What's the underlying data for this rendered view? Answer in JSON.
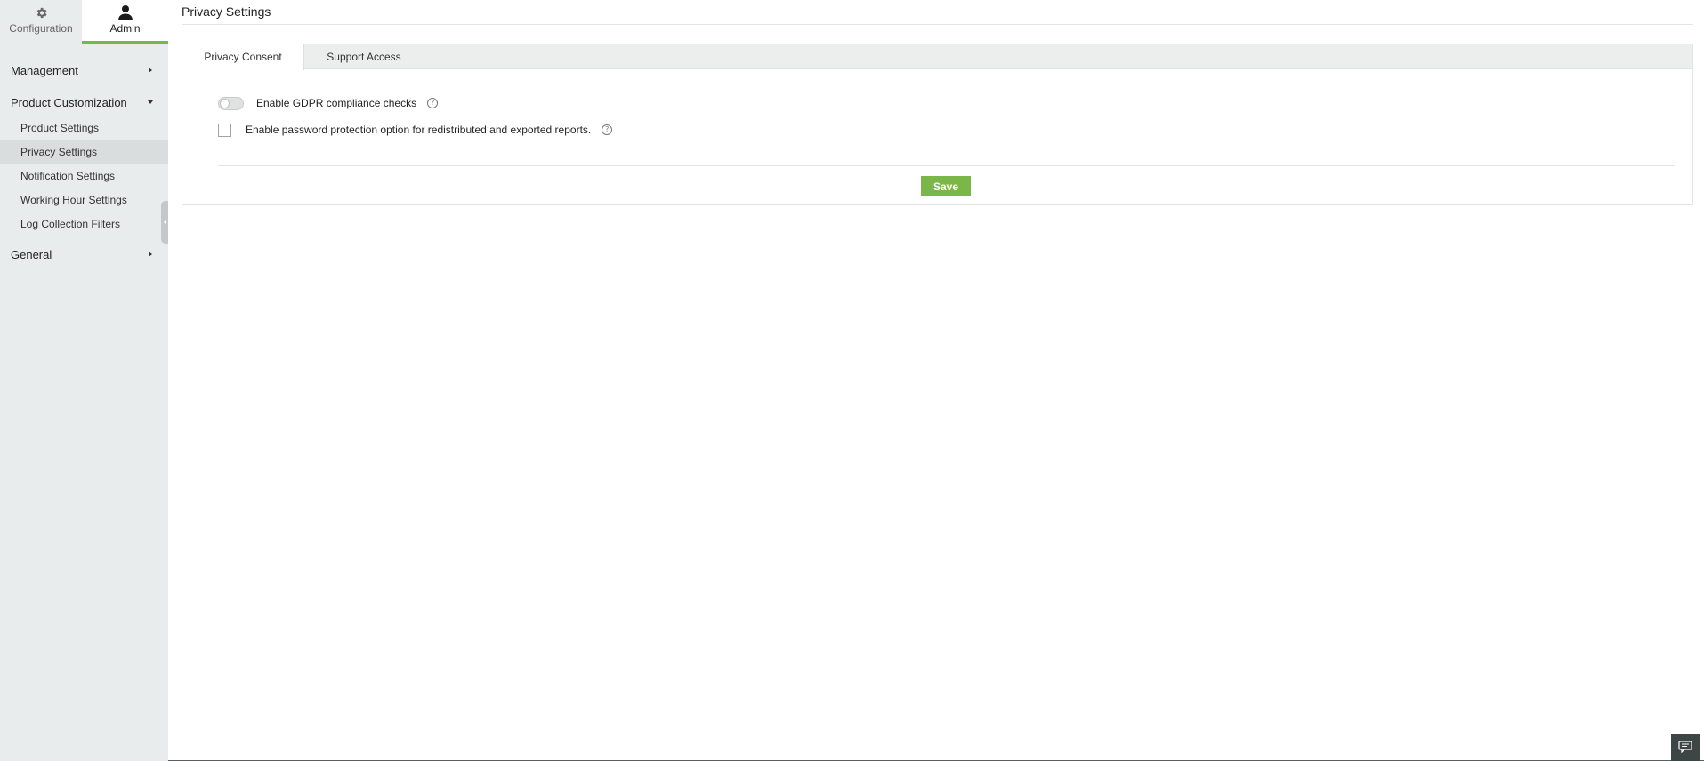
{
  "sidebar": {
    "tabs": [
      {
        "label": "Configuration",
        "icon": "gear-icon"
      },
      {
        "label": "Admin",
        "icon": "user-icon"
      }
    ],
    "groups": [
      {
        "label": "Management",
        "expanded": false
      },
      {
        "label": "Product Customization",
        "expanded": true,
        "items": [
          "Product Settings",
          "Privacy Settings",
          "Notification Settings",
          "Working Hour Settings",
          "Log Collection Filters"
        ]
      },
      {
        "label": "General",
        "expanded": false
      }
    ],
    "active_item": "Privacy Settings"
  },
  "page": {
    "title": "Privacy Settings",
    "tabs": [
      "Privacy Consent",
      "Support Access"
    ],
    "active_tab": "Privacy Consent",
    "options": [
      {
        "label": "Enable GDPR compliance checks",
        "control": "toggle",
        "checked": false
      },
      {
        "label": "Enable password protection option for redistributed and exported reports.",
        "control": "checkbox",
        "checked": false
      }
    ],
    "help_glyph": "?",
    "save_label": "Save"
  },
  "colors": {
    "accent": "#7ab648",
    "sidebar_bg": "#e9ecec",
    "active_item_bg": "#dadddd"
  }
}
